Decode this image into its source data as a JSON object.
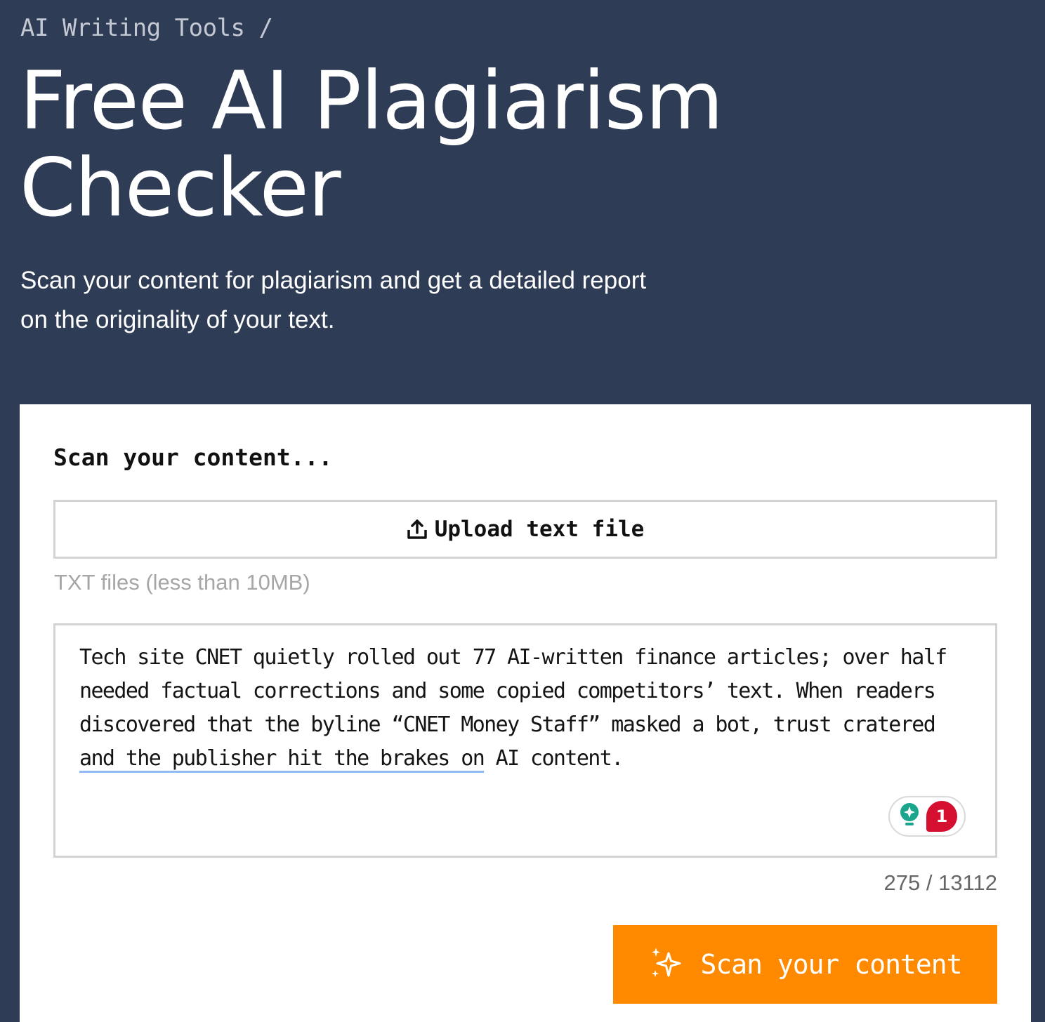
{
  "breadcrumb": {
    "label": "AI Writing Tools /"
  },
  "header": {
    "title": "Free AI Plagiarism Checker",
    "subtitle": "Scan your content for plagiarism and get a detailed report on the originality of your text."
  },
  "card": {
    "heading": "Scan your content...",
    "upload": {
      "label": "Upload text file",
      "icon": "upload-icon",
      "hint": "TXT files (less than 10MB)"
    },
    "editor": {
      "text_before": "Tech site CNET quietly rolled out 77 AI-written finance articles; over half needed factual corrections and some copied competitors’ text. When readers discovered that the byline “CNET Money Staff” masked a bot, trust cratered ",
      "text_underlined": "and the publisher hit the brakes on",
      "text_after": " AI content.",
      "underline_color": "#90baf0"
    },
    "assistant": {
      "icon": "lightbulb-icon",
      "badge_count": "1",
      "badge_color": "#d40f2f",
      "icon_color": "#1aa58c"
    },
    "counter": "275 / 13112",
    "scan_button": {
      "label": "Scan your content",
      "icon": "sparkle-icon",
      "color": "#ff8a00"
    }
  },
  "colors": {
    "header_bg": "#2f3c56",
    "card_bg": "#ffffff"
  }
}
